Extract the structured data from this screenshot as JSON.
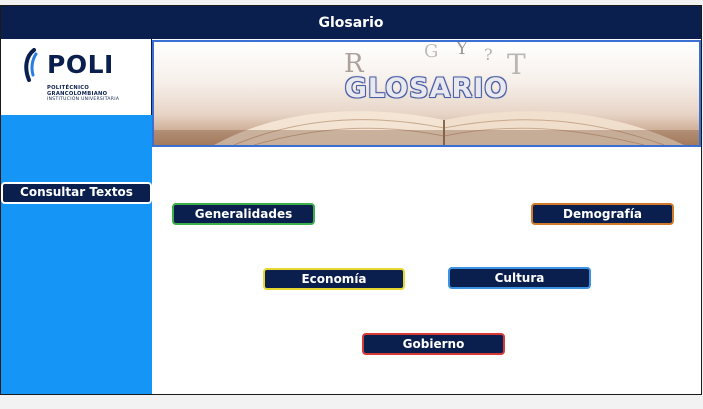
{
  "window": {
    "title": "Glosario"
  },
  "logo": {
    "name": "POLI",
    "line1": "POLITÉCNICO",
    "line2": "GRANCOLOMBIANO",
    "line3": "INSTITUCIÓN UNIVERSITARIA"
  },
  "sidebar": {
    "consult_label": "Consultar Textos"
  },
  "banner": {
    "title": "GLOSARIO",
    "letters": [
      "R",
      "G",
      "Y",
      "T",
      "?"
    ]
  },
  "topics": {
    "generalidades": "Generalidades",
    "demografia": "Demografía",
    "economia": "Economía",
    "cultura": "Cultura",
    "gobierno": "Gobierno"
  },
  "colors": {
    "navy": "#0a1f4e",
    "sidebar_blue": "#1596f6",
    "generalidades_border": "#3cae4a",
    "demografia_border": "#d07a2a",
    "economia_border": "#e8d730",
    "cultura_border": "#3c92e3",
    "gobierno_border": "#d83a3a"
  }
}
